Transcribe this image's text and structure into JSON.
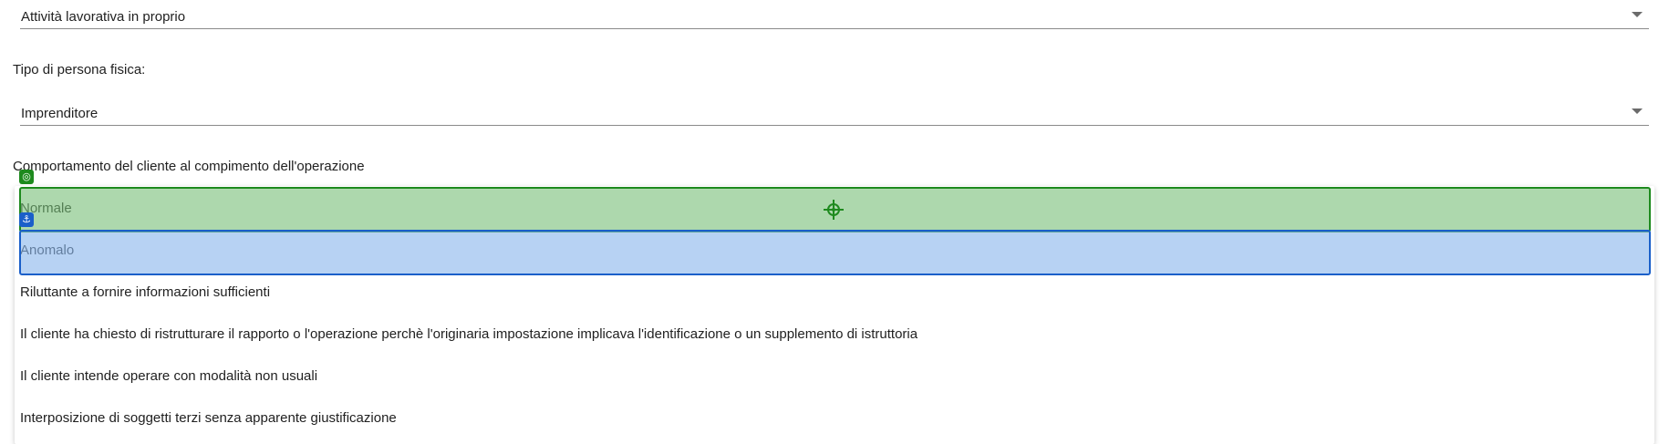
{
  "fields": {
    "attivita": {
      "value": "Attività lavorativa in proprio"
    },
    "tipo_persona": {
      "label": "Tipo di persona fisica:",
      "value": "Imprenditore"
    },
    "comportamento": {
      "label": "Comportamento del cliente al compimento dell'operazione"
    }
  },
  "dropdown": {
    "options": [
      "Normale",
      "Anomalo",
      "Riluttante a fornire informazioni sufficienti",
      "Il cliente ha chiesto di ristrutturare il rapporto o l'operazione perchè l'originaria impostazione implicava l'identificazione o un supplemento di istruttoria",
      "Il cliente intende operare con modalità non usuali",
      "Interposizione di soggetti terzi senza apparente giustificazione"
    ]
  },
  "overlay": {
    "green_icon": "target-icon",
    "blue_icon": "anchor-icon"
  },
  "colors": {
    "green_highlight": "#76be76",
    "blue_highlight": "#8ab6ec"
  }
}
